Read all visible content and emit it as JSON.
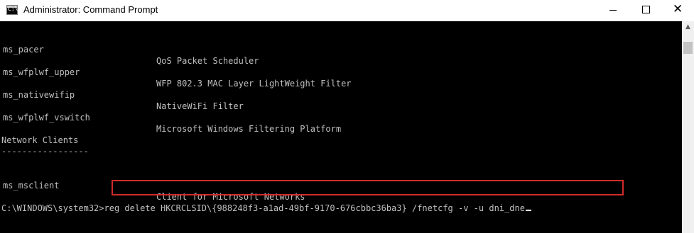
{
  "window": {
    "title": "Administrator: Command Prompt",
    "icon": "console-icon"
  },
  "controls": {
    "minimize_icon": "minimize-icon",
    "maximize_icon": "maximize-icon",
    "close_icon": "close-icon"
  },
  "console": {
    "rows": [
      {
        "name": "ms_pacer",
        "desc": "QoS Packet Scheduler"
      },
      {
        "name": "ms_wfplwf_upper",
        "desc": "WFP 802.3 MAC Layer LightWeight Filter"
      },
      {
        "name": "ms_nativewifip",
        "desc": "NativeWiFi Filter"
      },
      {
        "name": "ms_wfplwf_vswitch",
        "desc": "Microsoft Windows Filtering Platform"
      }
    ],
    "section_heading": "Network Clients",
    "section_rule": "-----------------",
    "client_row": {
      "name": "ms_msclient",
      "desc": "Client for Microsoft Networks"
    },
    "prompt": "C:\\WINDOWS\\system32>",
    "command": "reg delete HKCRCLSID\\{988248f3-a1ad-49bf-9170-676cbbc36ba3} /fnetcfg -v -u dni_dne"
  },
  "colors": {
    "console_bg": "#000000",
    "console_text": "#c0c0c0",
    "highlight_border": "#d12b2b"
  }
}
